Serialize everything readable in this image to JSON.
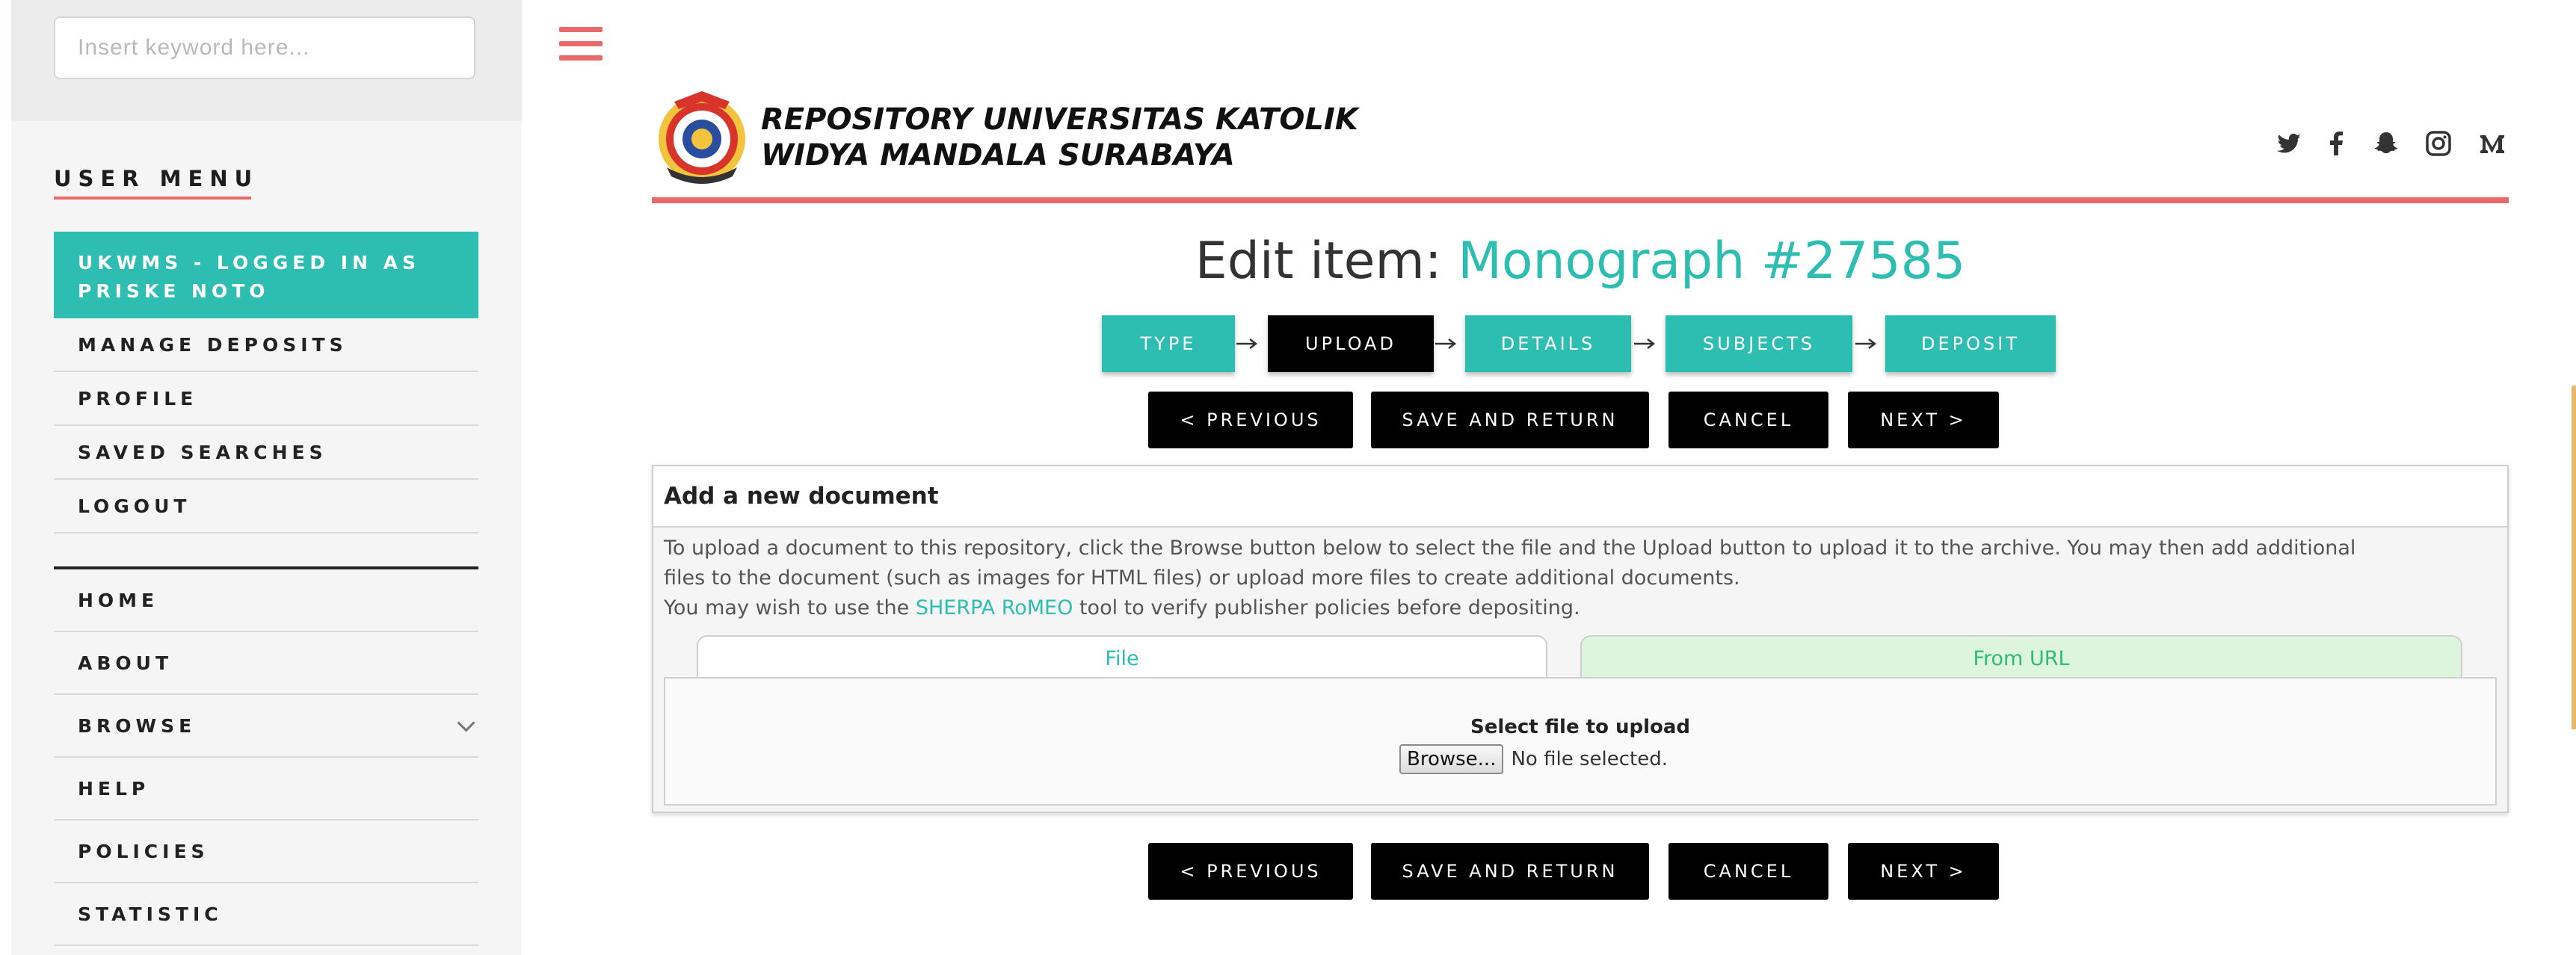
{
  "search": {
    "placeholder": "Insert keyword here..."
  },
  "sidebar": {
    "user_menu_title": "USER MENU",
    "logged_in": "UKWMS - LOGGED IN AS PRISKE NOTO",
    "user_items": [
      {
        "label": "MANAGE DEPOSITS"
      },
      {
        "label": "PROFILE"
      },
      {
        "label": "SAVED SEARCHES"
      },
      {
        "label": "LOGOUT"
      }
    ],
    "nav_items": [
      {
        "label": "HOME"
      },
      {
        "label": "ABOUT"
      },
      {
        "label": "BROWSE"
      },
      {
        "label": "HELP"
      },
      {
        "label": "POLICIES"
      },
      {
        "label": "STATISTIC"
      }
    ]
  },
  "header": {
    "title_line1": "REPOSITORY UNIVERSITAS KATOLIK",
    "title_line2": "WIDYA MANDALA SURABAYA",
    "social_icons": [
      "twitter-icon",
      "facebook-icon",
      "snapchat-icon",
      "instagram-icon",
      "medium-icon"
    ]
  },
  "page": {
    "title_prefix": "Edit item: ",
    "title_item": "Monograph #27585"
  },
  "steps": [
    {
      "label": "TYPE",
      "active": false
    },
    {
      "label": "UPLOAD",
      "active": true
    },
    {
      "label": "DETAILS",
      "active": false
    },
    {
      "label": "SUBJECTS",
      "active": false
    },
    {
      "label": "DEPOSIT",
      "active": false
    }
  ],
  "actions": {
    "previous": "< PREVIOUS",
    "save_return": "SAVE AND RETURN",
    "cancel": "CANCEL",
    "next": "NEXT >"
  },
  "panel": {
    "heading": "Add a new document",
    "text_line1": "To upload a document to this repository, click the Browse button below to select the file and the Upload button to upload it to the archive. You may then add additional",
    "text_line2": "files to the document (such as images for HTML files) or upload more files to create additional documents.",
    "text_line3_before": "You may wish to use the ",
    "text_line3_link": "SHERPA RoMEO",
    "text_line3_after": " tool to verify publisher policies before depositing.",
    "tabs": [
      {
        "label": "File"
      },
      {
        "label": "From URL"
      }
    ],
    "select_label": "Select file to upload",
    "browse_label": "Browse...",
    "no_file": "No file selected."
  },
  "colors": {
    "accent": "#2dbdb1",
    "brand_red": "#e96a6a",
    "active_step": "#000000"
  }
}
